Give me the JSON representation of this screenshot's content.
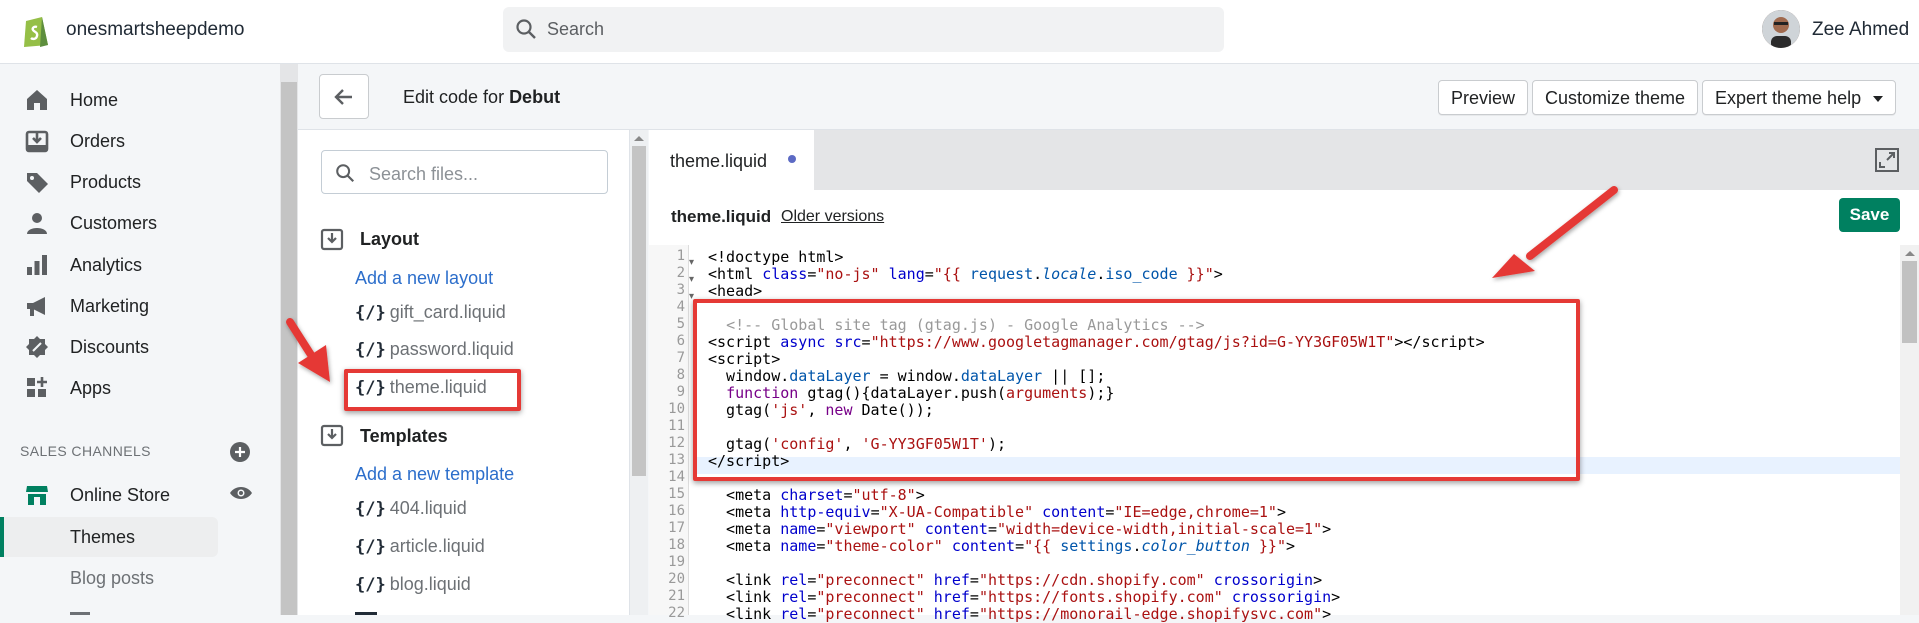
{
  "topbar": {
    "store_name": "onesmartsheepdemo",
    "search_placeholder": "Search",
    "user_name": "Zee Ahmed"
  },
  "nav": {
    "items": [
      {
        "label": "Home",
        "icon": "home-icon"
      },
      {
        "label": "Orders",
        "icon": "orders-icon"
      },
      {
        "label": "Products",
        "icon": "tag-icon"
      },
      {
        "label": "Customers",
        "icon": "person-icon"
      },
      {
        "label": "Analytics",
        "icon": "bar-chart-icon"
      },
      {
        "label": "Marketing",
        "icon": "megaphone-icon"
      },
      {
        "label": "Discounts",
        "icon": "discount-icon"
      },
      {
        "label": "Apps",
        "icon": "apps-icon"
      }
    ],
    "sales_channels_heading": "SALES CHANNELS",
    "online_store": "Online Store",
    "themes": "Themes",
    "blog_posts": "Blog posts"
  },
  "header": {
    "edit_prefix": "Edit code for ",
    "theme_name": "Debut",
    "preview": "Preview",
    "customize": "Customize theme",
    "expert_help": "Expert theme help"
  },
  "files": {
    "search_placeholder": "Search files...",
    "layout_heading": "Layout",
    "add_layout": "Add a new layout",
    "layout_files": [
      "gift_card.liquid",
      "password.liquid",
      "theme.liquid"
    ],
    "templates_heading": "Templates",
    "add_template": "Add a new template",
    "template_files": [
      "404.liquid",
      "article.liquid",
      "blog.liquid"
    ],
    "file_icon_text": "{/}"
  },
  "editor": {
    "tab_label": "theme.liquid",
    "file_name": "theme.liquid",
    "older_versions": "Older versions",
    "save": "Save",
    "line_numbers": [
      "1",
      "2",
      "3",
      "4",
      "5",
      "6",
      "7",
      "8",
      "9",
      "10",
      "11",
      "12",
      "13",
      "14",
      "15",
      "16",
      "17",
      "18",
      "19",
      "20",
      "21",
      "22"
    ]
  },
  "colors": {
    "accent": "#008060",
    "link": "#2c6ecb",
    "annotation": "#e53935"
  }
}
